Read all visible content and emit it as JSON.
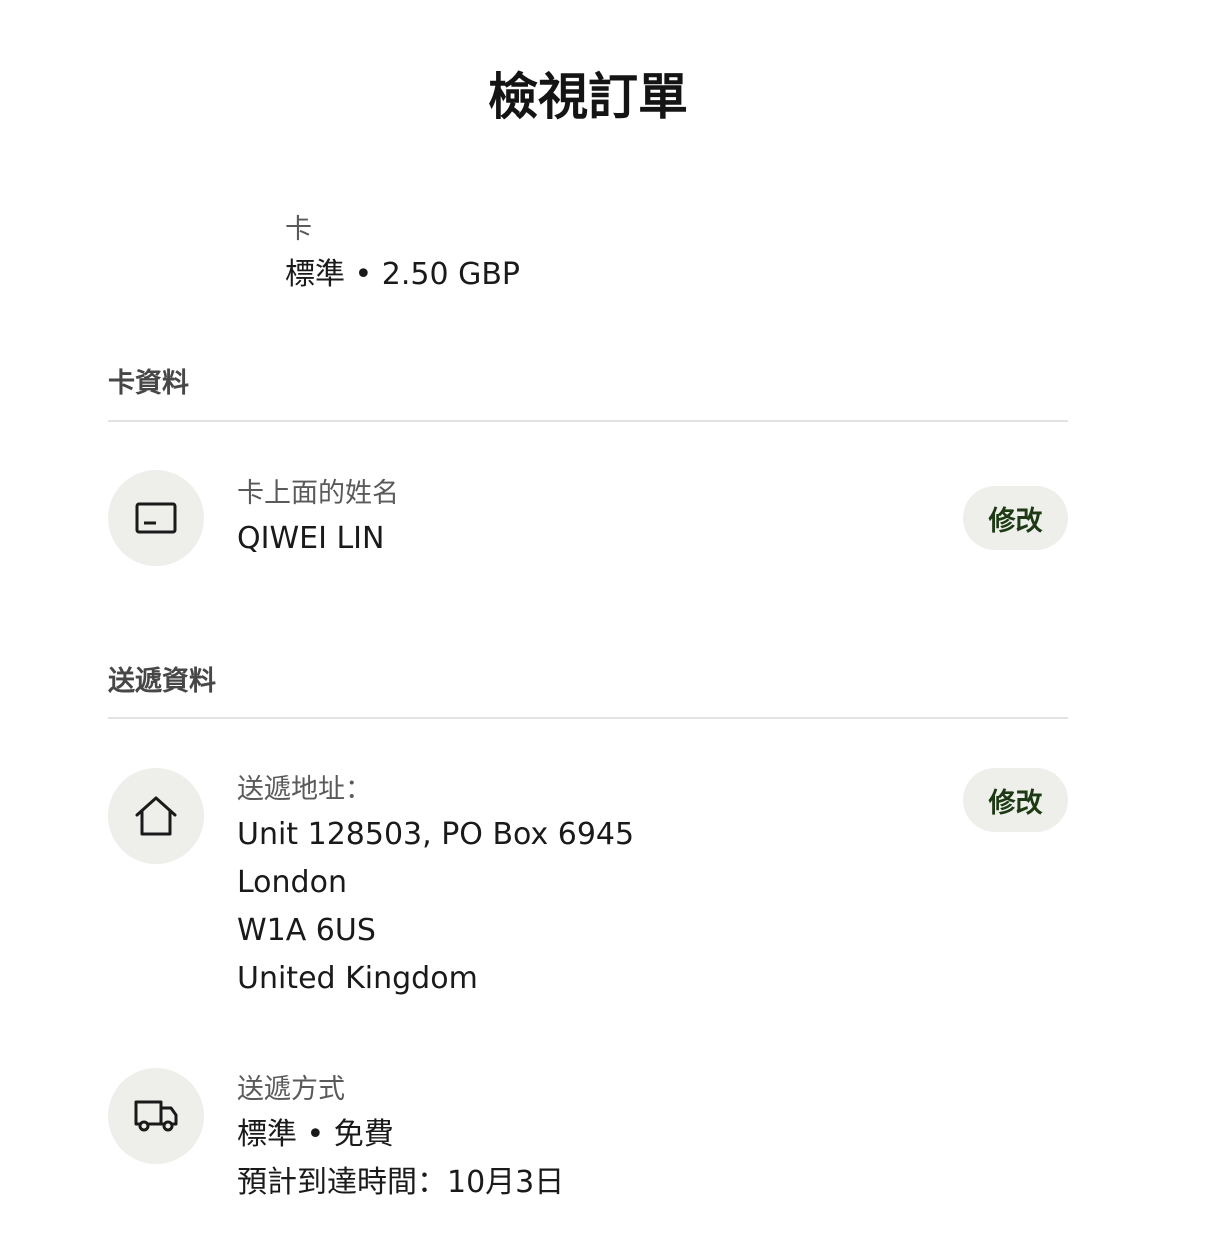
{
  "header": {
    "title": "檢視訂單"
  },
  "card_summary": {
    "label": "卡",
    "value": "標準 • 2.50 GBP"
  },
  "card_section": {
    "heading": "卡資料",
    "name_row": {
      "icon": "credit-card-icon",
      "label": "卡上面的姓名",
      "value": "QIWEI LIN",
      "edit_label": "修改"
    }
  },
  "delivery_section": {
    "heading": "送遞資料",
    "address_row": {
      "icon": "home-icon",
      "label": "送遞地址：",
      "lines": [
        "Unit 128503, PO Box 6945",
        "London",
        "W1A 6US",
        "United Kingdom"
      ],
      "edit_label": "修改"
    },
    "method_row": {
      "icon": "truck-icon",
      "label": "送遞方式",
      "value": "標準 • 免費",
      "eta": "預計到達時間：10月3日"
    }
  },
  "colors": {
    "icon_circle_bg": "#eeefeb",
    "button_text": "#1d3a14",
    "divider": "#e2e2e2"
  }
}
